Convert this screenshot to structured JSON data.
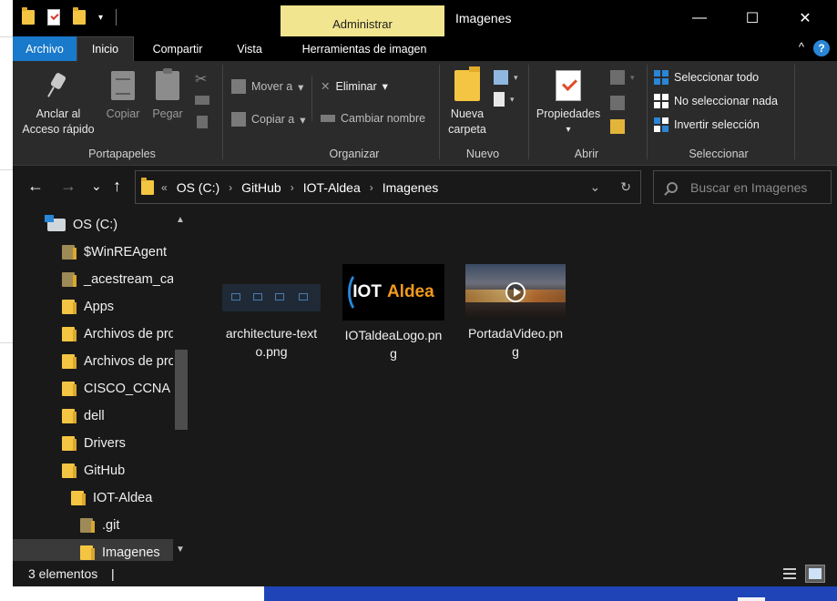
{
  "window": {
    "title": "Imagenes",
    "contextual_tab": "Administrar",
    "buttons": {
      "minimize": "—",
      "maximize": "☐",
      "close": "✕"
    },
    "qat_dropdown": "▾"
  },
  "tabs": {
    "archivo": "Archivo",
    "inicio": "Inicio",
    "compartir": "Compartir",
    "vista": "Vista",
    "herramientas": "Herramientas de imagen",
    "collapse": "^",
    "help": "?"
  },
  "ribbon": {
    "portapapeles": {
      "label": "Portapapeles",
      "anclar_line1": "Anclar al",
      "anclar_line2": "Acceso rápido",
      "copiar": "Copiar",
      "pegar": "Pegar",
      "cut_icon": "✂"
    },
    "organizar": {
      "label": "Organizar",
      "mover": "Mover a",
      "copiar_a": "Copiar a",
      "eliminar": "Eliminar",
      "cambiar_nombre": "Cambiar nombre",
      "drop": "▾",
      "delete_icon": "✕"
    },
    "nuevo": {
      "label": "Nuevo",
      "carpeta_line1": "Nueva",
      "carpeta_line2": "carpeta"
    },
    "abrir": {
      "label": "Abrir",
      "propiedades": "Propiedades",
      "drop": "▾"
    },
    "seleccionar": {
      "label": "Seleccionar",
      "todo": "Seleccionar todo",
      "nada": "No seleccionar nada",
      "invertir": "Invertir selección"
    }
  },
  "address": {
    "back": "←",
    "forward": "→",
    "recent": "⌄",
    "up": "↑",
    "overflow": "«",
    "sep": "›",
    "crumbs": [
      "OS (C:)",
      "GitHub",
      "IOT-Aldea",
      "Imagenes"
    ],
    "dropdown": "⌄",
    "refresh": "↻"
  },
  "search": {
    "placeholder": "Buscar en Imagenes"
  },
  "nav": {
    "drive": "OS (C:)",
    "items": [
      {
        "label": "$WinREAgent"
      },
      {
        "label": "_acestream_cac"
      },
      {
        "label": "Apps"
      },
      {
        "label": "Archivos de pro"
      },
      {
        "label": "Archivos de pro"
      },
      {
        "label": "CISCO_CCNA"
      },
      {
        "label": "dell"
      },
      {
        "label": "Drivers"
      },
      {
        "label": "GitHub"
      },
      {
        "label": "IOT-Aldea"
      },
      {
        "label": ".git"
      },
      {
        "label": "Imagenes"
      }
    ],
    "scroll_up": "▲",
    "scroll_down": "▼"
  },
  "files": [
    {
      "name_line1": "architecture-text",
      "name_line2": "o.png"
    },
    {
      "name_line1": "IOTaldeaLogo.pn",
      "name_line2": "g",
      "logo_iot": "IOT",
      "logo_aldea": "Aldea"
    },
    {
      "name_line1": "PortadaVideo.pn",
      "name_line2": "g"
    }
  ],
  "status": {
    "count": "3 elementos",
    "bar": "|"
  },
  "colors": {
    "accent": "#1979ca",
    "admin_tab": "#f2e58f",
    "folder": "#f4c542",
    "logo_orange": "#f29a1c"
  }
}
